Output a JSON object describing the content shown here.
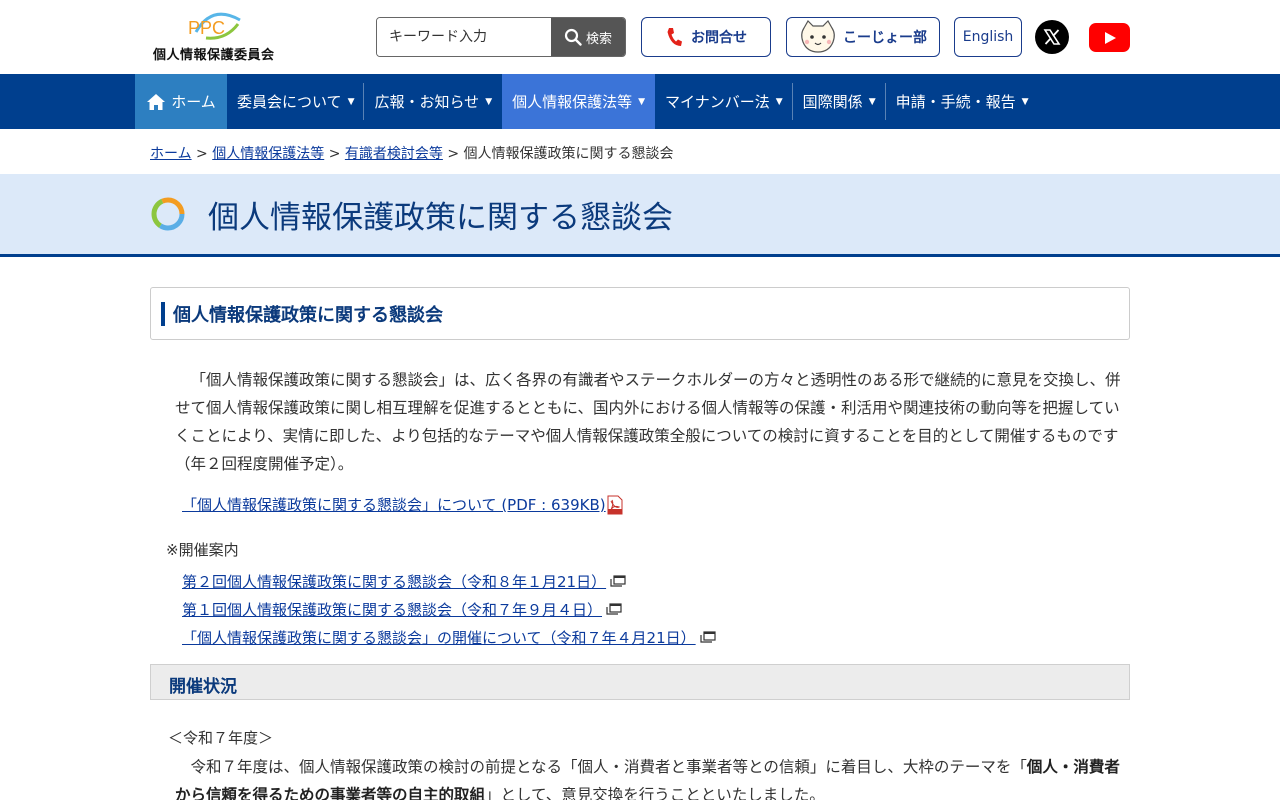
{
  "header": {
    "logo_mark": "PPC",
    "logo_text": "個人情報保護委員会",
    "search_placeholder": "キーワード入力",
    "search_button": "検索",
    "contact_label": "お問合せ",
    "kojo_label": "こーじょー部",
    "english_label": "English",
    "icons": [
      "search-icon",
      "phone-icon",
      "mascot-icon",
      "x-logo-icon",
      "youtube-icon"
    ]
  },
  "nav": {
    "items": [
      {
        "label": "ホーム",
        "icon": "home-icon"
      },
      {
        "label": "委員会について"
      },
      {
        "label": "広報・お知らせ"
      },
      {
        "label": "個人情報保護法等"
      },
      {
        "label": "マイナンバー法"
      },
      {
        "label": "国際関係"
      },
      {
        "label": "申請・手続・報告"
      }
    ],
    "arrow": "▼",
    "colors": {
      "bar": "#003f8e",
      "home": "#2d7fc1",
      "active": "#3b74d8"
    }
  },
  "breadcrumb": {
    "items": [
      "ホーム",
      "個人情報保護法等",
      "有識者検討会等"
    ],
    "current": "個人情報保護政策に関する懇談会",
    "separator": ">"
  },
  "page": {
    "title": "個人情報保護政策に関する懇談会",
    "heading": "個人情報保護政策に関する懇談会",
    "intro": "「個人情報保護政策に関する懇談会」は、広く各界の有識者やステークホルダーの方々と透明性のある形で継続的に意見を交換し、併せて個人情報保護政策に関し相互理解を促進するとともに、国内外における個人情報等の保護・利活用や関連技術の動向等を把握していくことにより、実情に即した、より包括的なテーマや個人情報保護政策全般についての検討に資することを目的として開催するものです（年２回程度開催予定）。",
    "pdf_link": "「個人情報保護政策に関する懇談会」について (PDF : 639KB)",
    "notice_label": "※開催案内",
    "event_links": [
      "第２回個人情報保護政策に関する懇談会（令和８年１月21日）",
      "第１回個人情報保護政策に関する懇談会（令和７年９月４日）",
      "「個人情報保護政策に関する懇談会」の開催について（令和７年４月21日）"
    ],
    "section_heading": "開催状況",
    "year_label": "＜令和７年度＞",
    "para2_a": "令和７年度は、個人情報保護政策の検討の前提となる「個人・消費者と事業者等との信頼」に着目し、大枠のテーマを「",
    "para2_bold": "個人・消費者から信頼を得るための事業者等の自主的取組",
    "para2_b": "」として、意見交換を行うことといたしました。"
  }
}
